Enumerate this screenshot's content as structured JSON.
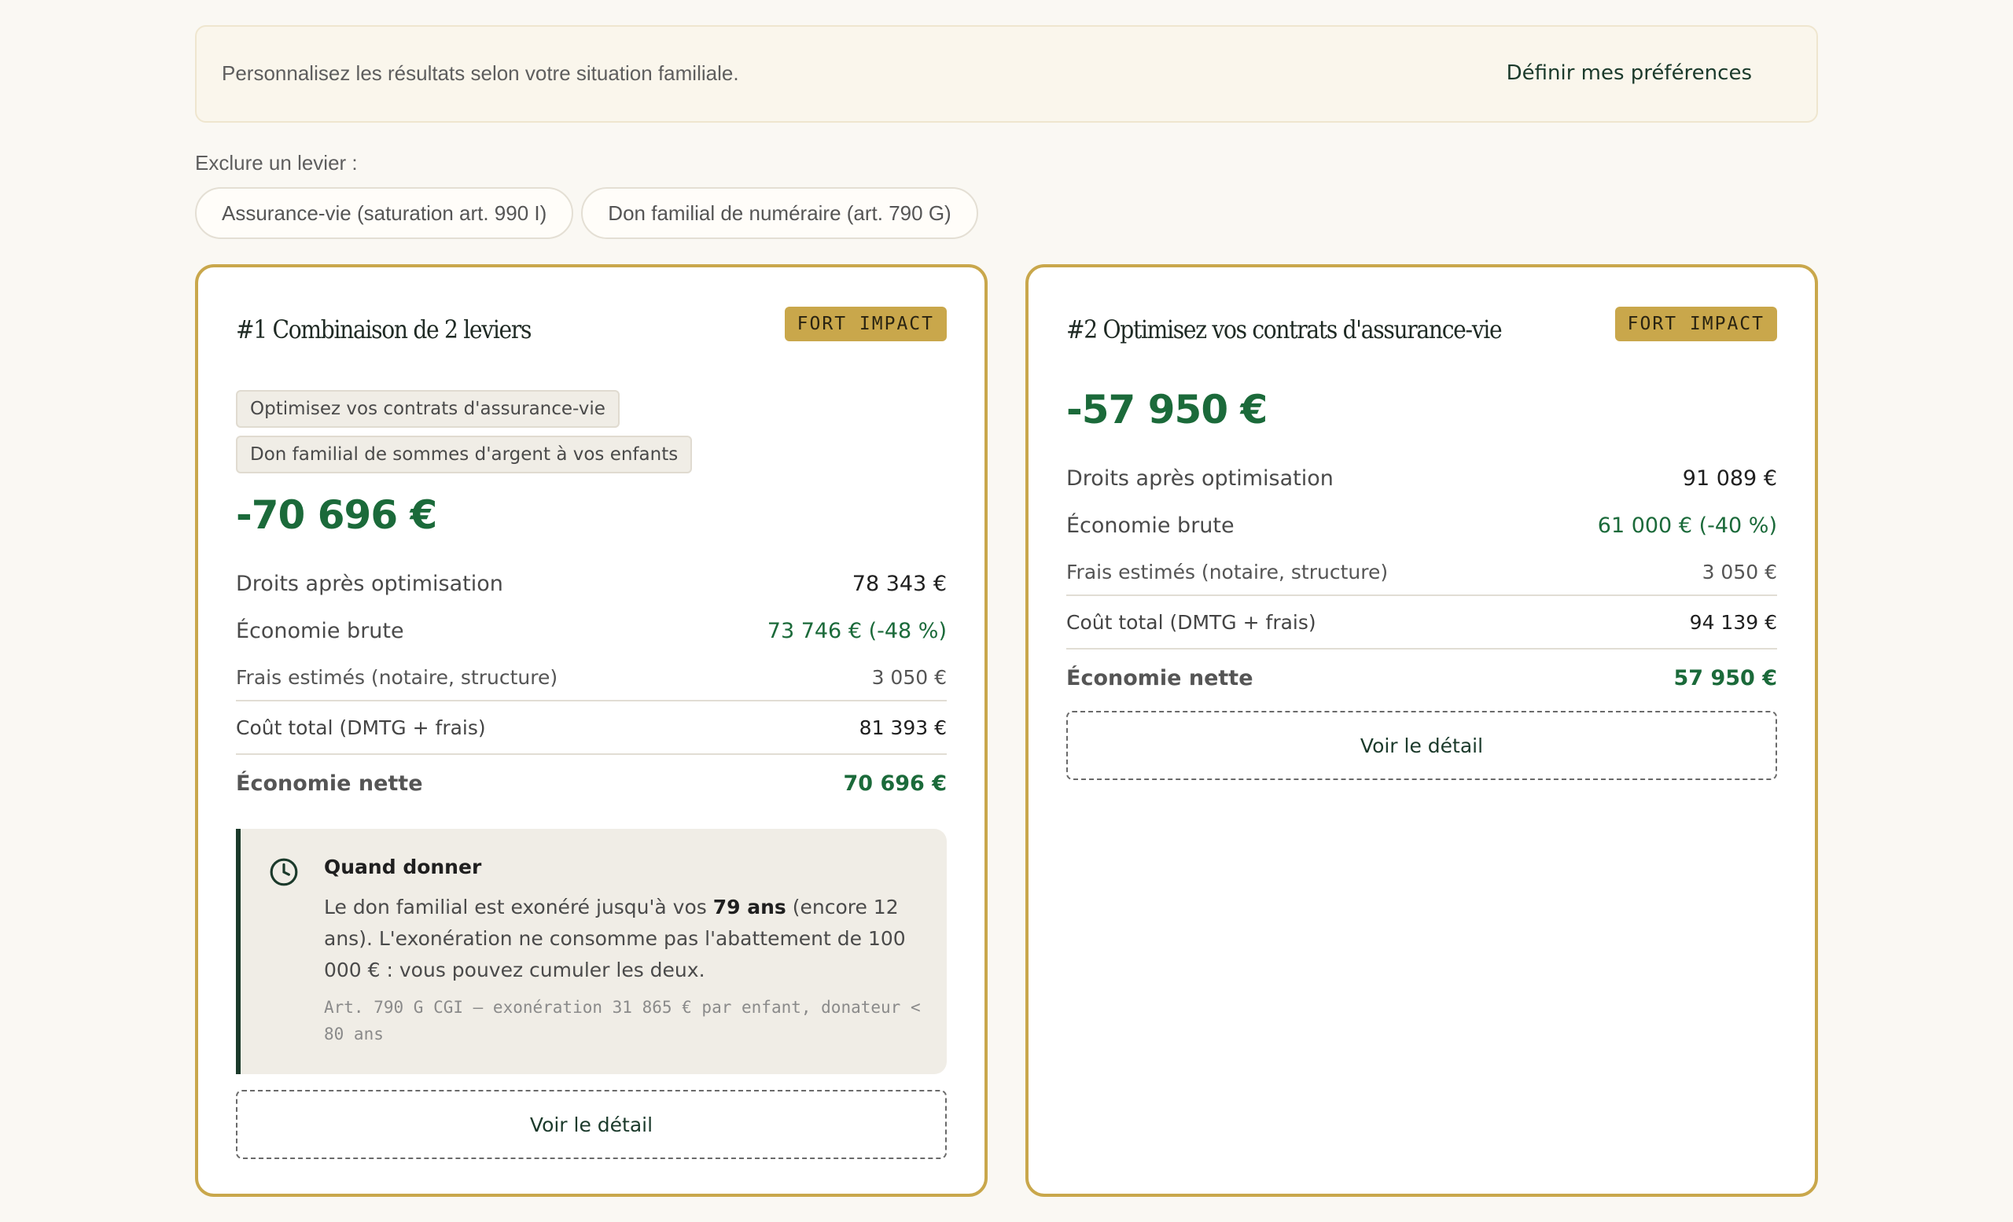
{
  "preferences": {
    "text": "Personnalisez les résultats selon votre situation familiale.",
    "button": "Définir mes préférences"
  },
  "exclude": {
    "label": "Exclure un levier :",
    "chips": [
      "Assurance-vie (saturation art. 990 I)",
      "Don familial de numéraire (art. 790 G)"
    ]
  },
  "cards": [
    {
      "title": "#1 Combinaison de 2 leviers",
      "badge": "FORT IMPACT",
      "tags": [
        "Optimisez vos contrats d'assurance-vie",
        "Don familial de sommes d'argent à vos enfants"
      ],
      "saving": "-70 696 €",
      "rows": {
        "droits": {
          "label": "Droits après optimisation",
          "value": "78 343 €"
        },
        "eco": {
          "label": "Économie brute",
          "value": "73 746 € (-48 %)"
        },
        "frais": {
          "label": "Frais estimés (notaire, structure)",
          "value": "3 050 €"
        },
        "cout": {
          "label": "Coût total (DMTG + frais)",
          "value": "81 393 €"
        },
        "nette": {
          "label": "Économie nette",
          "value": "70 696 €"
        }
      },
      "when": {
        "title": "Quand donner",
        "body_before": "Le don familial est exonéré jusqu'à vos ",
        "body_bold": "79 ans",
        "body_after": " (encore 12 ans). L'exonération ne consomme pas l'abattement de 100 000 € : vous pouvez cumuler les deux.",
        "ref": "Art. 790 G CGI — exonération 31 865 € par enfant, donateur < 80 ans"
      },
      "detail": "Voir le détail"
    },
    {
      "title": "#2 Optimisez vos contrats d'assurance-vie",
      "badge": "FORT IMPACT",
      "saving": "-57 950 €",
      "rows": {
        "droits": {
          "label": "Droits après optimisation",
          "value": "91 089 €"
        },
        "eco": {
          "label": "Économie brute",
          "value": "61 000 € (-40 %)"
        },
        "frais": {
          "label": "Frais estimés (notaire, structure)",
          "value": "3 050 €"
        },
        "cout": {
          "label": "Coût total (DMTG + frais)",
          "value": "94 139 €"
        },
        "nette": {
          "label": "Économie nette",
          "value": "57 950 €"
        }
      },
      "detail": "Voir le détail"
    }
  ],
  "colors": {
    "accent_gold": "#c9a74b",
    "saving_green": "#1b6a3a",
    "dark_green": "#1b3a2b",
    "background": "#faf8f3"
  }
}
